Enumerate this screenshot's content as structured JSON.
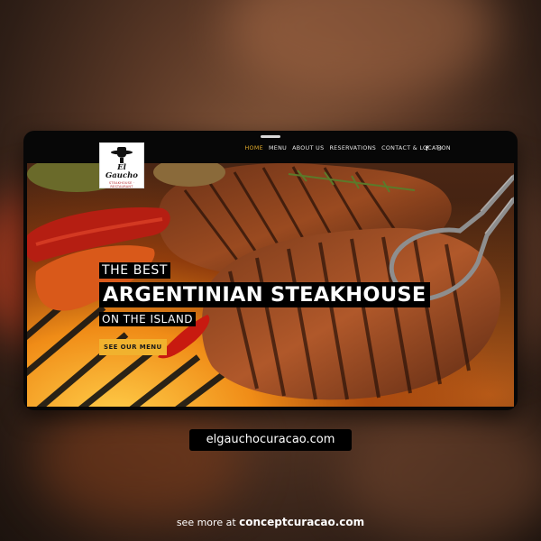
{
  "nav": {
    "items": [
      {
        "label": "HOME",
        "active": true
      },
      {
        "label": "MENU",
        "active": false
      },
      {
        "label": "ABOUT US",
        "active": false
      },
      {
        "label": "RESERVATIONS",
        "active": false
      },
      {
        "label": "CONTACT & LOCATION",
        "active": false
      }
    ],
    "social": [
      {
        "name": "facebook-icon",
        "glyph": "f"
      },
      {
        "name": "instagram-icon",
        "glyph": "◎"
      }
    ],
    "active_color": "#e2ab2a"
  },
  "logo": {
    "name": "El Gaucho",
    "tagline": "STEAKHOUSE · RESTAURANT"
  },
  "hero": {
    "line1": "THE BEST",
    "line2": "ARGENTINIAN STEAKHOUSE",
    "line3": "ON THE ISLAND",
    "cta_label": "SEE OUR MENU",
    "cta_color": "#f1b22e"
  },
  "site_url": "elgauchocuracao.com",
  "footer": {
    "prefix": "see more at",
    "brand": "conceptcuracao.com"
  }
}
